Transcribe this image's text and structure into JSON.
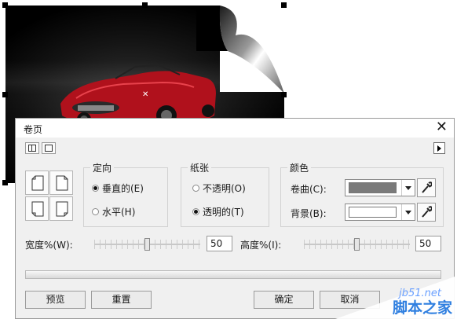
{
  "dialog": {
    "title": "卷页",
    "orientation": {
      "title": "定向",
      "options": [
        {
          "label": "垂直的(E)",
          "selected": true
        },
        {
          "label": "水平(H)",
          "selected": false
        }
      ]
    },
    "paper": {
      "title": "纸张",
      "options": [
        {
          "label": "不透明(O)",
          "selected": false
        },
        {
          "label": "透明的(T)",
          "selected": true
        }
      ]
    },
    "colors": {
      "title": "颜色",
      "curl_label": "卷曲(C):",
      "curl_color": "#7a7a7a",
      "background_label": "背景(B):",
      "background_color": "#ffffff"
    },
    "width_label": "宽度%(W):",
    "width_value": "50",
    "height_label": "高度%(I):",
    "height_value": "50",
    "buttons": {
      "preview": "预览",
      "reset": "重置",
      "ok": "确定",
      "cancel": "取消"
    }
  },
  "watermark": {
    "url": "jb51.net",
    "name": "脚本之家"
  },
  "icons": [
    "page-curl-corner-icon",
    "split-view-icon",
    "single-view-icon",
    "expand-arrow-icon",
    "eyedropper-icon",
    "close-icon"
  ]
}
